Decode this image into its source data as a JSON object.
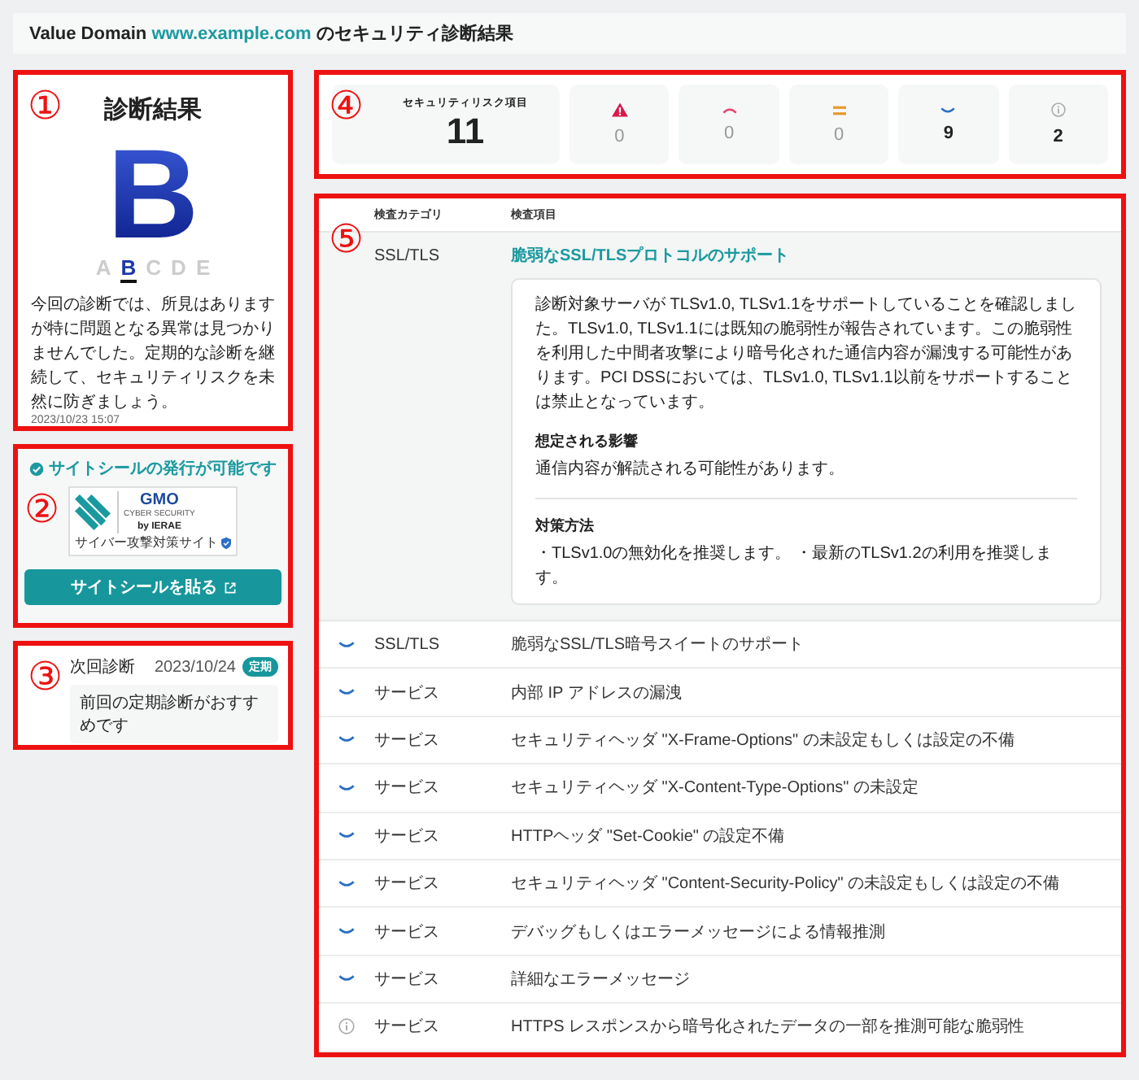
{
  "header": {
    "brand": "Value Domain",
    "domain": "www.example.com",
    "suffix": "のセキュリティ診断結果"
  },
  "result_panel": {
    "marker": "①",
    "title": "診断結果",
    "grade": "B",
    "scale": [
      {
        "letter": "A",
        "selected": false
      },
      {
        "letter": "B",
        "selected": true
      },
      {
        "letter": "C",
        "selected": false
      },
      {
        "letter": "D",
        "selected": false
      },
      {
        "letter": "E",
        "selected": false
      }
    ],
    "message": "今回の診断では、所見はありますが特に問題となる異常は見つかりませんでした。定期的な診断を継続して、セキュリティリスクを未然に防ぎましょう。",
    "timestamp": "2023/10/23 15:07"
  },
  "seal_panel": {
    "marker": "②",
    "notice": "サイトシールの発行が可能です",
    "seal": {
      "brand": "GMO",
      "line_1": "CYBER SECURITY",
      "line_2": "by IERAE",
      "caption": "サイバー攻撃対策サイト"
    },
    "button": "サイトシールを貼る"
  },
  "next_panel": {
    "marker": "③",
    "title": "次回診断",
    "date": "2023/10/24",
    "badge": "定期",
    "message": "前回の定期診断がおすすめです"
  },
  "stats_panel": {
    "marker": "④",
    "stats": [
      {
        "kind": "total",
        "label": "セキュリティリスク項目",
        "value": "11",
        "muted": false
      },
      {
        "kind": "critical",
        "value": "0",
        "muted": true
      },
      {
        "kind": "high",
        "value": "0",
        "muted": true
      },
      {
        "kind": "medium",
        "value": "0",
        "muted": true
      },
      {
        "kind": "low",
        "value": "9",
        "muted": false
      },
      {
        "kind": "info",
        "value": "2",
        "muted": false
      }
    ]
  },
  "findings_panel": {
    "marker": "⑤",
    "columns": [
      "検査カテゴリ",
      "検査項目"
    ],
    "expanded": {
      "category": "SSL/TLS",
      "title": "脆弱なSSL/TLSプロトコルのサポート",
      "description": "診断対象サーバが TLSv1.0, TLSv1.1をサポートしていることを確認しました。TLSv1.0, TLSv1.1には既知の脆弱性が報告されています。この脆弱性を利用した中間者攻撃により暗号化された通信内容が漏洩する可能性があります。PCI DSSにおいては、TLSv1.0, TLSv1.1以前をサポートすることは禁止となっています。",
      "impact_heading": "想定される影響",
      "impact": "通信内容が解読される可能性があります。",
      "remedy_heading": "対策方法",
      "remedy": "・TLSv1.0の無効化を推奨します。 ・最新のTLSv1.2の利用を推奨します。"
    },
    "rows": [
      {
        "kind": "low",
        "category": "SSL/TLS",
        "item": "脆弱なSSL/TLS暗号スイートのサポート"
      },
      {
        "kind": "low",
        "category": "サービス",
        "item": "内部 IP アドレスの漏洩"
      },
      {
        "kind": "low",
        "category": "サービス",
        "item": "セキュリティヘッダ \"X-Frame-Options\" の未設定もしくは設定の不備"
      },
      {
        "kind": "low",
        "category": "サービス",
        "item": "セキュリティヘッダ \"X-Content-Type-Options\" の未設定"
      },
      {
        "kind": "low",
        "category": "サービス",
        "item": "HTTPヘッダ \"Set-Cookie\" の設定不備"
      },
      {
        "kind": "low",
        "category": "サービス",
        "item": "セキュリティヘッダ \"Content-Security-Policy\" の未設定もしくは設定の不備"
      },
      {
        "kind": "low",
        "category": "サービス",
        "item": "デバッグもしくはエラーメッセージによる情報推測"
      },
      {
        "kind": "low",
        "category": "サービス",
        "item": "詳細なエラーメッセージ"
      },
      {
        "kind": "info",
        "category": "サービス",
        "item": "HTTPS レスポンスから暗号化されたデータの一部を推測可能な脆弱性"
      }
    ]
  }
}
